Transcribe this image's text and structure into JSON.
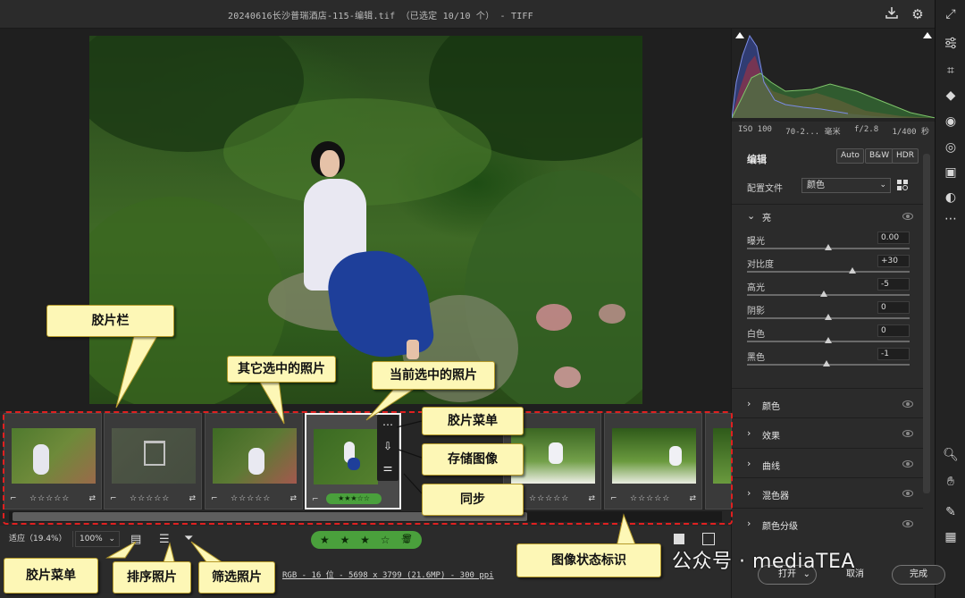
{
  "window": {
    "title": "20240616长沙普瑞酒店-115-编辑.tif （已选定 10/10 个） -  TIFF"
  },
  "histogram": {
    "iso": "ISO 100",
    "lens": "70-2... 毫米",
    "aperture": "f/2.8",
    "shutter": "1/400 秒"
  },
  "edit_panel": {
    "title": "编辑",
    "modes": [
      "Auto",
      "B&W",
      "HDR"
    ],
    "profile_label": "配置文件",
    "profile_value": "颜色",
    "light_section": "亮",
    "sliders": [
      {
        "label": "曝光",
        "value": "0.00",
        "pos": 0.5
      },
      {
        "label": "对比度",
        "value": "+30",
        "pos": 0.65
      },
      {
        "label": "高光",
        "value": "-5",
        "pos": 0.47
      },
      {
        "label": "阴影",
        "value": "0",
        "pos": 0.5
      },
      {
        "label": "白色",
        "value": "0",
        "pos": 0.5
      },
      {
        "label": "黑色",
        "value": "-1",
        "pos": 0.49
      }
    ],
    "collapsed_sections": [
      "颜色",
      "效果",
      "曲线",
      "混色器",
      "颜色分级"
    ]
  },
  "filmstrip": {
    "thumbs": [
      {
        "stars": "☆☆☆☆☆"
      },
      {
        "stars": "☆☆☆☆☆"
      },
      {
        "stars": "☆☆☆☆☆"
      },
      {
        "stars": "★★★☆☆"
      },
      {
        "stars": ""
      },
      {
        "stars": "☆☆☆☆☆"
      },
      {
        "stars": "☆☆☆☆☆"
      }
    ],
    "menu_icons": [
      "more-icon",
      "save-icon",
      "sync-icon"
    ]
  },
  "bottom_bar": {
    "fit_label": "适应（19.4%）",
    "zoom_value": "100%",
    "rating": "★ ★ ★ ☆ ☆",
    "info": "RGB - 16 位 - 5698 x 3799 (21.6MP) - 300 ppi",
    "open_label": "打开",
    "cancel_label": "取消",
    "done_label": "完成"
  },
  "callouts": {
    "filmstrip": "胶片栏",
    "other_selected": "其它选中的照片",
    "current_selected": "当前选中的照片",
    "film_menu": "胶片菜单",
    "save_image": "存储图像",
    "sync": "同步",
    "film_menu_bottom": "胶片菜单",
    "sort": "排序照片",
    "filter": "筛选照片",
    "status": "图像状态标识"
  },
  "watermark": "公众号 · mediaTEA"
}
